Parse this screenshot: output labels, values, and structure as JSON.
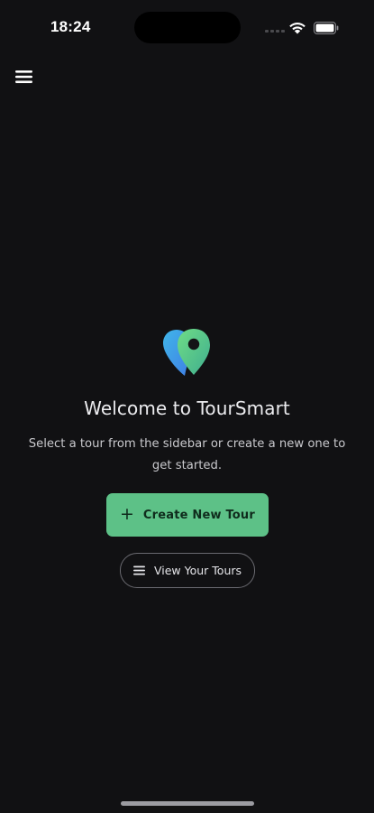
{
  "status_bar": {
    "time": "18:24"
  },
  "header": {
    "menu_icon": "hamburger-menu-icon"
  },
  "welcome": {
    "logo_icon": "map-pin-logo-icon",
    "title": "Welcome to TourSmart",
    "subtitle": "Select a tour from the sidebar or create a new one to get started."
  },
  "actions": {
    "create_label": "Create New Tour",
    "create_icon": "plus-icon",
    "view_label": "View Your Tours",
    "view_icon": "list-icon"
  },
  "colors": {
    "background": "#111113",
    "accent": "#5dc187",
    "logo_gradient_start": "#3aa0f0",
    "logo_gradient_end": "#5fd07a"
  }
}
